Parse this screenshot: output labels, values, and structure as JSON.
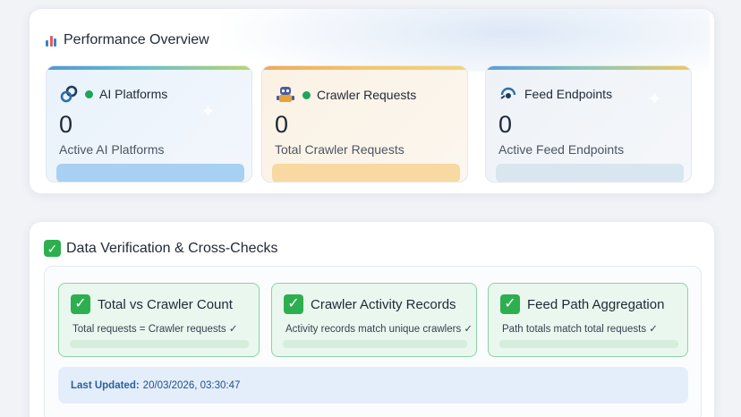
{
  "performance": {
    "title": "Performance Overview",
    "cards": [
      {
        "icon": "link-icon",
        "title": "AI Platforms",
        "status_color": "#1fa45a",
        "value": "0",
        "subtitle": "Active AI Platforms"
      },
      {
        "icon": "robot-icon",
        "title": "Crawler Requests",
        "status_color": "#1fa45a",
        "value": "0",
        "subtitle": "Total Crawler Requests"
      },
      {
        "icon": "feed-icon",
        "title": "Feed Endpoints",
        "status_color": "#1fa45a",
        "value": "0",
        "subtitle": "Active Feed Endpoints"
      }
    ]
  },
  "verification": {
    "title": "Data Verification & Cross-Checks",
    "checks": [
      {
        "title": "Total vs Crawler Count",
        "description": "Total requests = Crawler requests ✓"
      },
      {
        "title": "Crawler Activity Records",
        "description": "Activity records match unique crawlers ✓"
      },
      {
        "title": "Feed Path Aggregation",
        "description": "Path totals match total requests ✓"
      }
    ],
    "last_updated_label": "Last Updated:",
    "last_updated_value": "20/03/2026, 03:30:47"
  },
  "colors": {
    "success": "#2eaf4f",
    "ai_accent": "#a8d0f2",
    "crawler_accent": "#f7d9a1",
    "feed_accent": "#d8e6ef"
  }
}
